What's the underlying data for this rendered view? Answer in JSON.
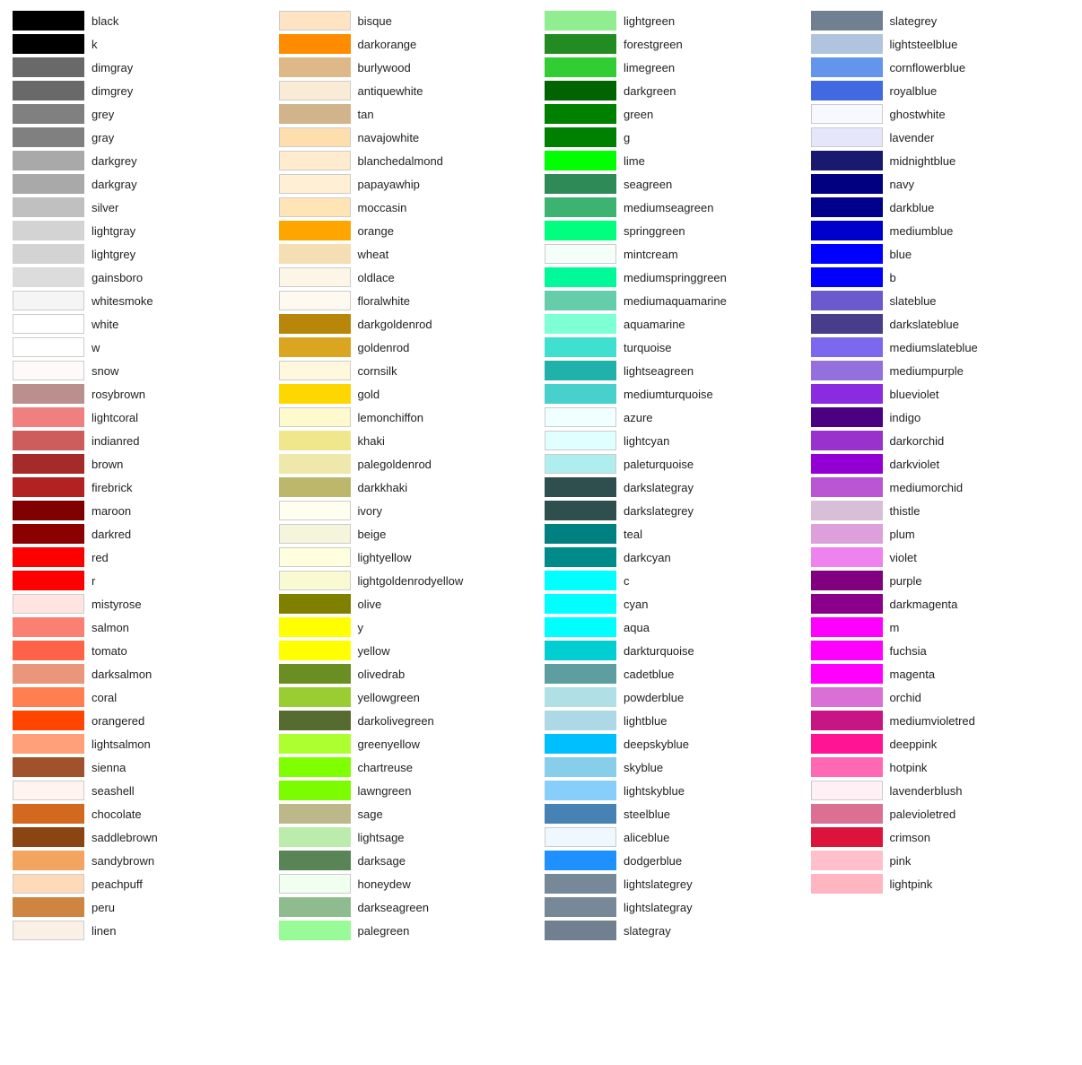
{
  "columns": [
    [
      {
        "name": "black",
        "color": "#000000"
      },
      {
        "name": "k",
        "color": "#000000"
      },
      {
        "name": "dimgray",
        "color": "#696969"
      },
      {
        "name": "dimgrey",
        "color": "#696969"
      },
      {
        "name": "grey",
        "color": "#808080"
      },
      {
        "name": "gray",
        "color": "#808080"
      },
      {
        "name": "darkgrey",
        "color": "#a9a9a9"
      },
      {
        "name": "darkgray",
        "color": "#a9a9a9"
      },
      {
        "name": "silver",
        "color": "#c0c0c0"
      },
      {
        "name": "lightgray",
        "color": "#d3d3d3"
      },
      {
        "name": "lightgrey",
        "color": "#d3d3d3"
      },
      {
        "name": "gainsboro",
        "color": "#dcdcdc"
      },
      {
        "name": "whitesmoke",
        "color": "#f5f5f5"
      },
      {
        "name": "white",
        "color": "#ffffff"
      },
      {
        "name": "w",
        "color": "#ffffff"
      },
      {
        "name": "snow",
        "color": "#fffafa"
      },
      {
        "name": "rosybrown",
        "color": "#bc8f8f"
      },
      {
        "name": "lightcoral",
        "color": "#f08080"
      },
      {
        "name": "indianred",
        "color": "#cd5c5c"
      },
      {
        "name": "brown",
        "color": "#a52a2a"
      },
      {
        "name": "firebrick",
        "color": "#b22222"
      },
      {
        "name": "maroon",
        "color": "#800000"
      },
      {
        "name": "darkred",
        "color": "#8b0000"
      },
      {
        "name": "red",
        "color": "#ff0000"
      },
      {
        "name": "r",
        "color": "#ff0000"
      },
      {
        "name": "mistyrose",
        "color": "#ffe4e1"
      },
      {
        "name": "salmon",
        "color": "#fa8072"
      },
      {
        "name": "tomato",
        "color": "#ff6347"
      },
      {
        "name": "darksalmon",
        "color": "#e9967a"
      },
      {
        "name": "coral",
        "color": "#ff7f50"
      },
      {
        "name": "orangered",
        "color": "#ff4500"
      },
      {
        "name": "lightsalmon",
        "color": "#ffa07a"
      },
      {
        "name": "sienna",
        "color": "#a0522d"
      },
      {
        "name": "seashell",
        "color": "#fff5ee"
      },
      {
        "name": "chocolate",
        "color": "#d2691e"
      },
      {
        "name": "saddlebrown",
        "color": "#8b4513"
      },
      {
        "name": "sandybrown",
        "color": "#f4a460"
      },
      {
        "name": "peachpuff",
        "color": "#ffdab9"
      },
      {
        "name": "peru",
        "color": "#cd853f"
      },
      {
        "name": "linen",
        "color": "#faf0e6"
      }
    ],
    [
      {
        "name": "bisque",
        "color": "#ffe4c4"
      },
      {
        "name": "darkorange",
        "color": "#ff8c00"
      },
      {
        "name": "burlywood",
        "color": "#deb887"
      },
      {
        "name": "antiquewhite",
        "color": "#faebd7"
      },
      {
        "name": "tan",
        "color": "#d2b48c"
      },
      {
        "name": "navajowhite",
        "color": "#ffdead"
      },
      {
        "name": "blanchedalmond",
        "color": "#ffebcd"
      },
      {
        "name": "papayawhip",
        "color": "#ffefd5"
      },
      {
        "name": "moccasin",
        "color": "#ffe4b5"
      },
      {
        "name": "orange",
        "color": "#ffa500"
      },
      {
        "name": "wheat",
        "color": "#f5deb3"
      },
      {
        "name": "oldlace",
        "color": "#fdf5e6"
      },
      {
        "name": "floralwhite",
        "color": "#fffaf0"
      },
      {
        "name": "darkgoldenrod",
        "color": "#b8860b"
      },
      {
        "name": "goldenrod",
        "color": "#daa520"
      },
      {
        "name": "cornsilk",
        "color": "#fff8dc"
      },
      {
        "name": "gold",
        "color": "#ffd700"
      },
      {
        "name": "lemonchiffon",
        "color": "#fffacd"
      },
      {
        "name": "khaki",
        "color": "#f0e68c"
      },
      {
        "name": "palegoldenrod",
        "color": "#eee8aa"
      },
      {
        "name": "darkkhaki",
        "color": "#bdb76b"
      },
      {
        "name": "ivory",
        "color": "#fffff0"
      },
      {
        "name": "beige",
        "color": "#f5f5dc"
      },
      {
        "name": "lightyellow",
        "color": "#ffffe0"
      },
      {
        "name": "lightgoldenrodyellow",
        "color": "#fafad2"
      },
      {
        "name": "olive",
        "color": "#808000"
      },
      {
        "name": "y",
        "color": "#ffff00"
      },
      {
        "name": "yellow",
        "color": "#ffff00"
      },
      {
        "name": "olivedrab",
        "color": "#6b8e23"
      },
      {
        "name": "yellowgreen",
        "color": "#9acd32"
      },
      {
        "name": "darkolivegreen",
        "color": "#556b2f"
      },
      {
        "name": "greenyellow",
        "color": "#adff2f"
      },
      {
        "name": "chartreuse",
        "color": "#7fff00"
      },
      {
        "name": "lawngreen",
        "color": "#7cfc00"
      },
      {
        "name": "sage",
        "color": "#bcb88a"
      },
      {
        "name": "lightsage",
        "color": "#bcecac"
      },
      {
        "name": "darksage",
        "color": "#598556"
      },
      {
        "name": "honeydew",
        "color": "#f0fff0"
      },
      {
        "name": "darkseagreen",
        "color": "#8fbc8f"
      },
      {
        "name": "palegreen",
        "color": "#98fb98"
      }
    ],
    [
      {
        "name": "lightgreen",
        "color": "#90ee90"
      },
      {
        "name": "forestgreen",
        "color": "#228b22"
      },
      {
        "name": "limegreen",
        "color": "#32cd32"
      },
      {
        "name": "darkgreen",
        "color": "#006400"
      },
      {
        "name": "green",
        "color": "#008000"
      },
      {
        "name": "g",
        "color": "#008000"
      },
      {
        "name": "lime",
        "color": "#00ff00"
      },
      {
        "name": "seagreen",
        "color": "#2e8b57"
      },
      {
        "name": "mediumseagreen",
        "color": "#3cb371"
      },
      {
        "name": "springgreen",
        "color": "#00ff7f"
      },
      {
        "name": "mintcream",
        "color": "#f5fffa"
      },
      {
        "name": "mediumspringgreen",
        "color": "#00fa9a"
      },
      {
        "name": "mediumaquamarine",
        "color": "#66cdaa"
      },
      {
        "name": "aquamarine",
        "color": "#7fffd4"
      },
      {
        "name": "turquoise",
        "color": "#40e0d0"
      },
      {
        "name": "lightseagreen",
        "color": "#20b2aa"
      },
      {
        "name": "mediumturquoise",
        "color": "#48d1cc"
      },
      {
        "name": "azure",
        "color": "#f0ffff"
      },
      {
        "name": "lightcyan",
        "color": "#e0ffff"
      },
      {
        "name": "paleturquoise",
        "color": "#afeeee"
      },
      {
        "name": "darkslategray",
        "color": "#2f4f4f"
      },
      {
        "name": "darkslategrey",
        "color": "#2f4f4f"
      },
      {
        "name": "teal",
        "color": "#008080"
      },
      {
        "name": "darkcyan",
        "color": "#008b8b"
      },
      {
        "name": "c",
        "color": "#00ffff"
      },
      {
        "name": "cyan",
        "color": "#00ffff"
      },
      {
        "name": "aqua",
        "color": "#00ffff"
      },
      {
        "name": "darkturquoise",
        "color": "#00ced1"
      },
      {
        "name": "cadetblue",
        "color": "#5f9ea0"
      },
      {
        "name": "powderblue",
        "color": "#b0e0e6"
      },
      {
        "name": "lightblue",
        "color": "#add8e6"
      },
      {
        "name": "deepskyblue",
        "color": "#00bfff"
      },
      {
        "name": "skyblue",
        "color": "#87ceeb"
      },
      {
        "name": "lightskyblue",
        "color": "#87cefa"
      },
      {
        "name": "steelblue",
        "color": "#4682b4"
      },
      {
        "name": "aliceblue",
        "color": "#f0f8ff"
      },
      {
        "name": "dodgerblue",
        "color": "#1e90ff"
      },
      {
        "name": "lightslategrey",
        "color": "#778899"
      },
      {
        "name": "lightslategray",
        "color": "#778899"
      },
      {
        "name": "slategray",
        "color": "#708090"
      }
    ],
    [
      {
        "name": "slategrey",
        "color": "#708090"
      },
      {
        "name": "lightsteelblue",
        "color": "#b0c4de"
      },
      {
        "name": "cornflowerblue",
        "color": "#6495ed"
      },
      {
        "name": "royalblue",
        "color": "#4169e1"
      },
      {
        "name": "ghostwhite",
        "color": "#f8f8ff"
      },
      {
        "name": "lavender",
        "color": "#e6e6fa"
      },
      {
        "name": "midnightblue",
        "color": "#191970"
      },
      {
        "name": "navy",
        "color": "#000080"
      },
      {
        "name": "darkblue",
        "color": "#00008b"
      },
      {
        "name": "mediumblue",
        "color": "#0000cd"
      },
      {
        "name": "blue",
        "color": "#0000ff"
      },
      {
        "name": "b",
        "color": "#0000ff"
      },
      {
        "name": "slateblue",
        "color": "#6a5acd"
      },
      {
        "name": "darkslateblue",
        "color": "#483d8b"
      },
      {
        "name": "mediumslateblue",
        "color": "#7b68ee"
      },
      {
        "name": "mediumpurple",
        "color": "#9370db"
      },
      {
        "name": "blueviolet",
        "color": "#8a2be2"
      },
      {
        "name": "indigo",
        "color": "#4b0082"
      },
      {
        "name": "darkorchid",
        "color": "#9932cc"
      },
      {
        "name": "darkviolet",
        "color": "#9400d3"
      },
      {
        "name": "mediumorchid",
        "color": "#ba55d3"
      },
      {
        "name": "thistle",
        "color": "#d8bfd8"
      },
      {
        "name": "plum",
        "color": "#dda0dd"
      },
      {
        "name": "violet",
        "color": "#ee82ee"
      },
      {
        "name": "purple",
        "color": "#800080"
      },
      {
        "name": "darkmagenta",
        "color": "#8b008b"
      },
      {
        "name": "m",
        "color": "#ff00ff"
      },
      {
        "name": "fuchsia",
        "color": "#ff00ff"
      },
      {
        "name": "magenta",
        "color": "#ff00ff"
      },
      {
        "name": "orchid",
        "color": "#da70d6"
      },
      {
        "name": "mediumvioletred",
        "color": "#c71585"
      },
      {
        "name": "deeppink",
        "color": "#ff1493"
      },
      {
        "name": "hotpink",
        "color": "#ff69b4"
      },
      {
        "name": "lavenderblush",
        "color": "#fff0f5"
      },
      {
        "name": "palevioletred",
        "color": "#db7093"
      },
      {
        "name": "crimson",
        "color": "#dc143c"
      },
      {
        "name": "pink",
        "color": "#ffc0cb"
      },
      {
        "name": "lightpink",
        "color": "#ffb6c1"
      }
    ]
  ]
}
